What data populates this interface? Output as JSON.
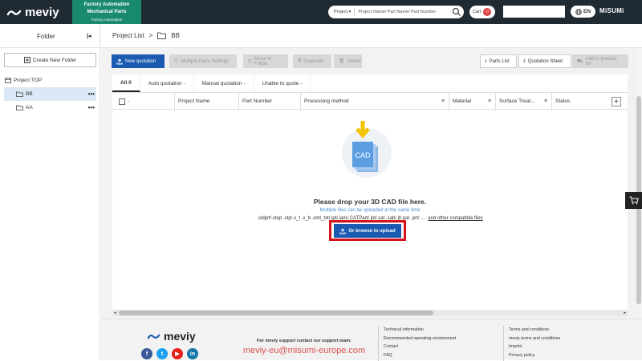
{
  "header": {
    "brand": "meviy",
    "category_line1": "Factory Automation",
    "category_line2": "Mechanical Parts",
    "category_sub": "Factory Automation",
    "search_scope": "Project",
    "search_placeholder": "Project Name/ Part Name/ Part Number",
    "cart_label": "Cart",
    "cart_count": "0",
    "language": "EN",
    "company": "MiSUMi"
  },
  "sidebar": {
    "title": "Folder",
    "new_folder_label": "Create New Folder",
    "root_label": "Project TOP",
    "items": [
      {
        "label": "BB",
        "active": true
      },
      {
        "label": "AA",
        "active": false
      }
    ],
    "more": "•••"
  },
  "breadcrumb": {
    "root": "Project List",
    "current": "BB"
  },
  "toolbar": {
    "new_quotation": "New quotation",
    "multiple_parts_settings": "Multiple Parts Settings",
    "move_to_folder": "Move to Folder",
    "duplicate": "Duplicate",
    "delete": "Delete",
    "parts_list": "Parts List",
    "quotation_sheet": "Quotation Sheet",
    "add_to_product_list": "Add to product list"
  },
  "tabs": [
    {
      "label": "All",
      "count": "0"
    },
    {
      "label": "Auto quotation -"
    },
    {
      "label": "Manual quotation -"
    },
    {
      "label": "Unable to quote -"
    }
  ],
  "table": {
    "select_label": "-",
    "columns": [
      "Project Name",
      "Part Number",
      "Processing method",
      "Material",
      "Surface Treat...",
      "Status"
    ],
    "add_column": "+"
  },
  "dropzone": {
    "icon_text": "CAD",
    "title": "Please drop your 3D CAD file here.",
    "subtitle": "Multiple files can be uploaded at the same time",
    "formats": ".sldprt/.step .stp/.x_t .x_b .xmt_txt/.ipt/.iam/.CATPart/.ipt/.sat .sab/.jt/.par .prt/ ...",
    "compatible_link": "and other compatible files",
    "upload_button": "Or browse to upload"
  },
  "footer": {
    "brand": "meviy",
    "support_text": "For meviy support contact our support team:",
    "support_email": "meviy-eu@misumi-europe.com",
    "social": [
      "f",
      "t",
      "▶",
      "in"
    ],
    "links_col1": [
      "Technical information",
      "Recommended operating environment",
      "Contact",
      "FAQ"
    ],
    "links_col2": [
      "Terms and conditions",
      "meviy terms and conditions",
      "Imprint",
      "Privacy policy"
    ]
  },
  "colors": {
    "header_bg": "#202a33",
    "category_bg": "#1a8a6e",
    "primary": "#1a5ab0",
    "highlight": "#d4141a",
    "email": "#d9534f"
  }
}
